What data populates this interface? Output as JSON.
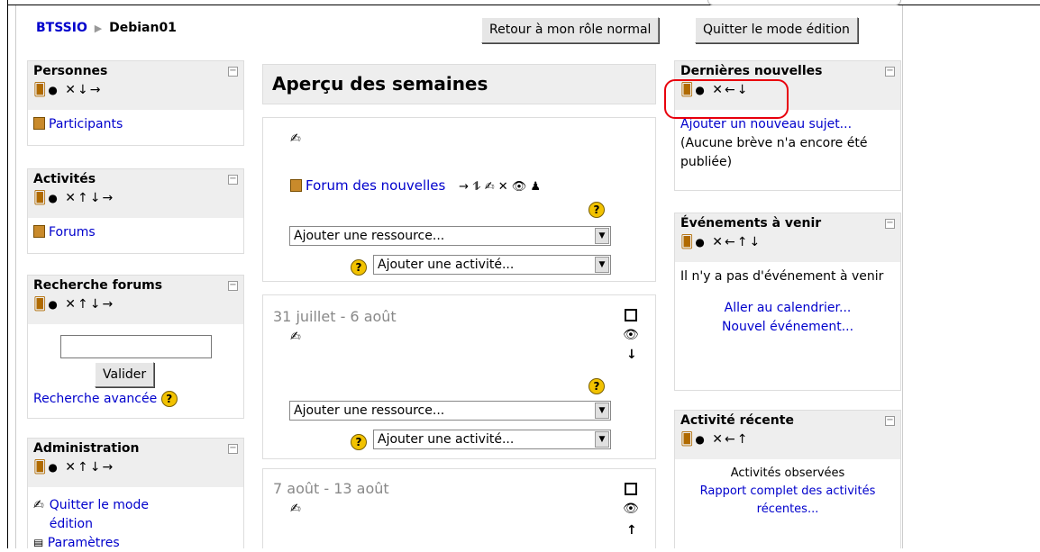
{
  "breadcrumb": {
    "root": "BTSSIO",
    "separator": "▶",
    "current": "Debian01"
  },
  "header_buttons": {
    "role": "Retour à mon rôle normal",
    "edit": "Quitter le mode édition"
  },
  "icons": {
    "roles": "people-icon",
    "visibility": "eye-icon",
    "delete": "x-icon",
    "move_down": "arrow-down-icon",
    "move_up": "arrow-up-icon",
    "move_left": "arrow-left-icon",
    "move_right": "arrow-right-icon"
  },
  "left": {
    "personnes": {
      "title": "Personnes",
      "controls": "✕↓→",
      "link": "Participants"
    },
    "activites": {
      "title": "Activités",
      "controls": "✕↑↓→",
      "link": "Forums"
    },
    "recherche": {
      "title": "Recherche forums",
      "controls": "✕↑↓→",
      "button": "Valider",
      "advanced": "Recherche avancée",
      "help": "?"
    },
    "admin": {
      "title": "Administration",
      "controls": "✕↑↓→",
      "link": "Quitter le mode édition",
      "partial": "Paramètres"
    }
  },
  "center": {
    "title": "Aperçu des semaines",
    "s0": {
      "forum": "Forum des nouvelles",
      "forum_controls": "→ ⥮ ✍ ✕ 👁 ♟",
      "add_resource": "Ajouter une ressource...",
      "add_activity": "Ajouter une activité..."
    },
    "s1": {
      "dates": "31 juillet - 6 août",
      "add_resource": "Ajouter une ressource...",
      "add_activity": "Ajouter une activité..."
    },
    "s2": {
      "dates": "7 août - 13 août"
    }
  },
  "right": {
    "news": {
      "title": "Dernières nouvelles",
      "controls": "✕←↓",
      "link": "Ajouter un nouveau sujet...",
      "text": "(Aucune brève n'a encore été publiée)"
    },
    "events": {
      "title": "Événements à venir",
      "controls": "✕←↑↓",
      "text": "Il n'y a pas d'événement à venir",
      "link1": "Aller au calendrier...",
      "link2": "Nouvel événement..."
    },
    "recent": {
      "title": "Activité récente",
      "controls": "✕←↑",
      "text": "Activités observées",
      "link": "Rapport complet des activités récentes..."
    }
  },
  "colors": {
    "highlight": "#e8000d",
    "link": "#0000cc",
    "block_header": "#eeeeee"
  }
}
